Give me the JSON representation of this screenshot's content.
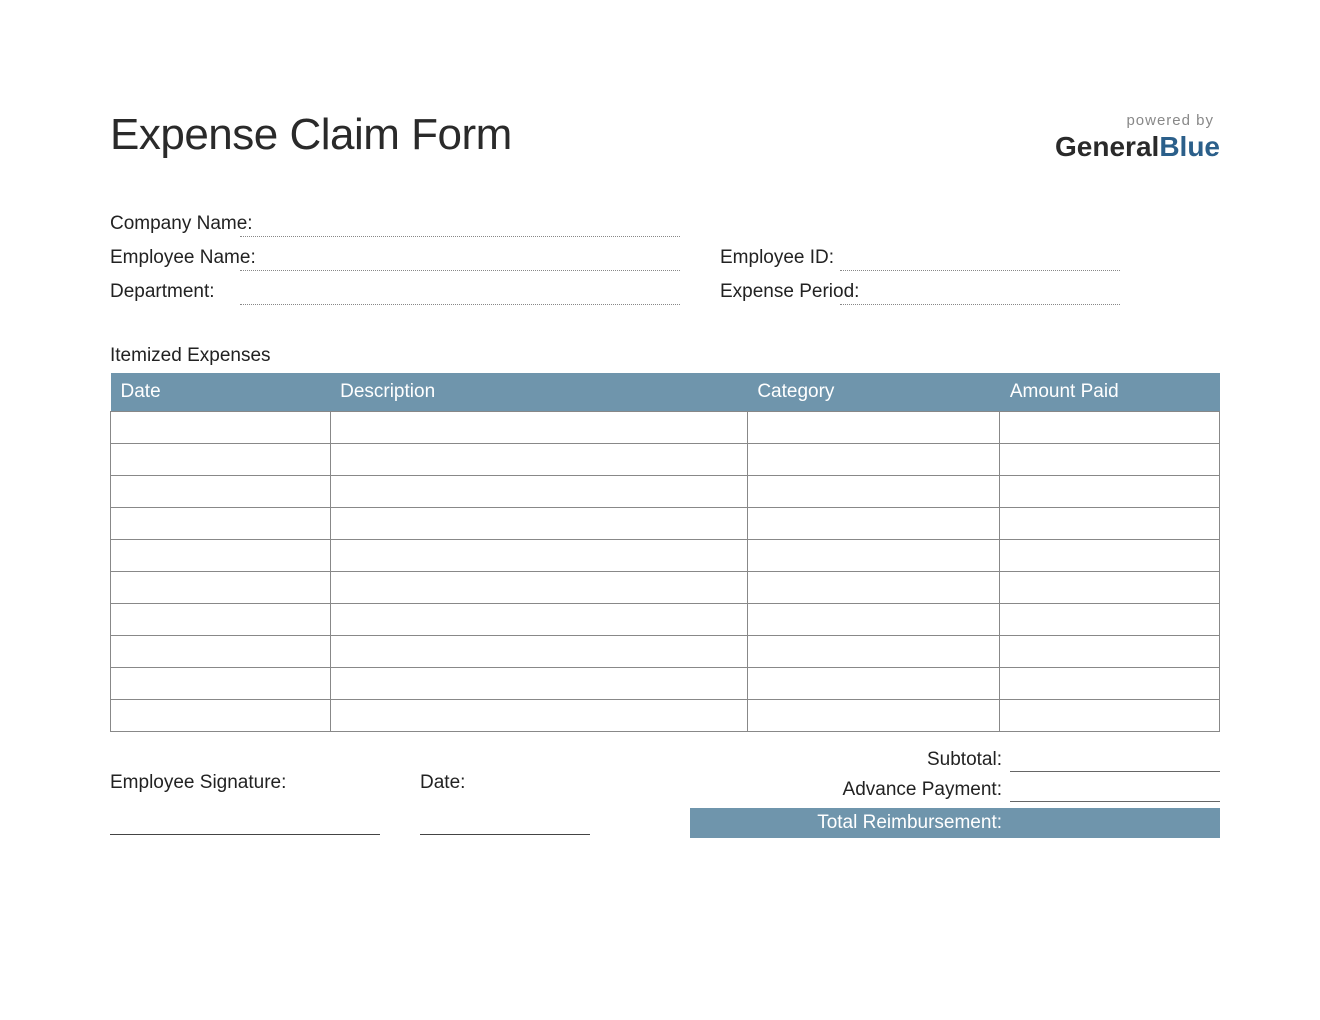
{
  "header": {
    "title": "Expense Claim Form",
    "powered_by": "powered by",
    "logo_part1": "General",
    "logo_part2": "Blue"
  },
  "info": {
    "company_label": "Company Name:",
    "employee_label": "Employee Name:",
    "employee_id_label": "Employee ID:",
    "department_label": "Department:",
    "period_label": "Expense Period:",
    "company_value": "",
    "employee_value": "",
    "employee_id_value": "",
    "department_value": "",
    "period_value": ""
  },
  "section": {
    "itemized_label": "Itemized Expenses"
  },
  "table": {
    "columns": [
      "Date",
      "Description",
      "Category",
      "Amount Paid"
    ],
    "rows": [
      [
        "",
        "",
        "",
        ""
      ],
      [
        "",
        "",
        "",
        ""
      ],
      [
        "",
        "",
        "",
        ""
      ],
      [
        "",
        "",
        "",
        ""
      ],
      [
        "",
        "",
        "",
        ""
      ],
      [
        "",
        "",
        "",
        ""
      ],
      [
        "",
        "",
        "",
        ""
      ],
      [
        "",
        "",
        "",
        ""
      ],
      [
        "",
        "",
        "",
        ""
      ],
      [
        "",
        "",
        "",
        ""
      ]
    ]
  },
  "signature": {
    "employee_sig_label": "Employee Signature:",
    "date_label": "Date:"
  },
  "totals": {
    "subtotal_label": "Subtotal:",
    "advance_label": "Advance Payment:",
    "total_label": "Total Reimbursement:",
    "subtotal_value": "",
    "advance_value": "",
    "total_value": ""
  },
  "colors": {
    "accent": "#6f95ac",
    "logo_blue": "#2b5f8a"
  }
}
